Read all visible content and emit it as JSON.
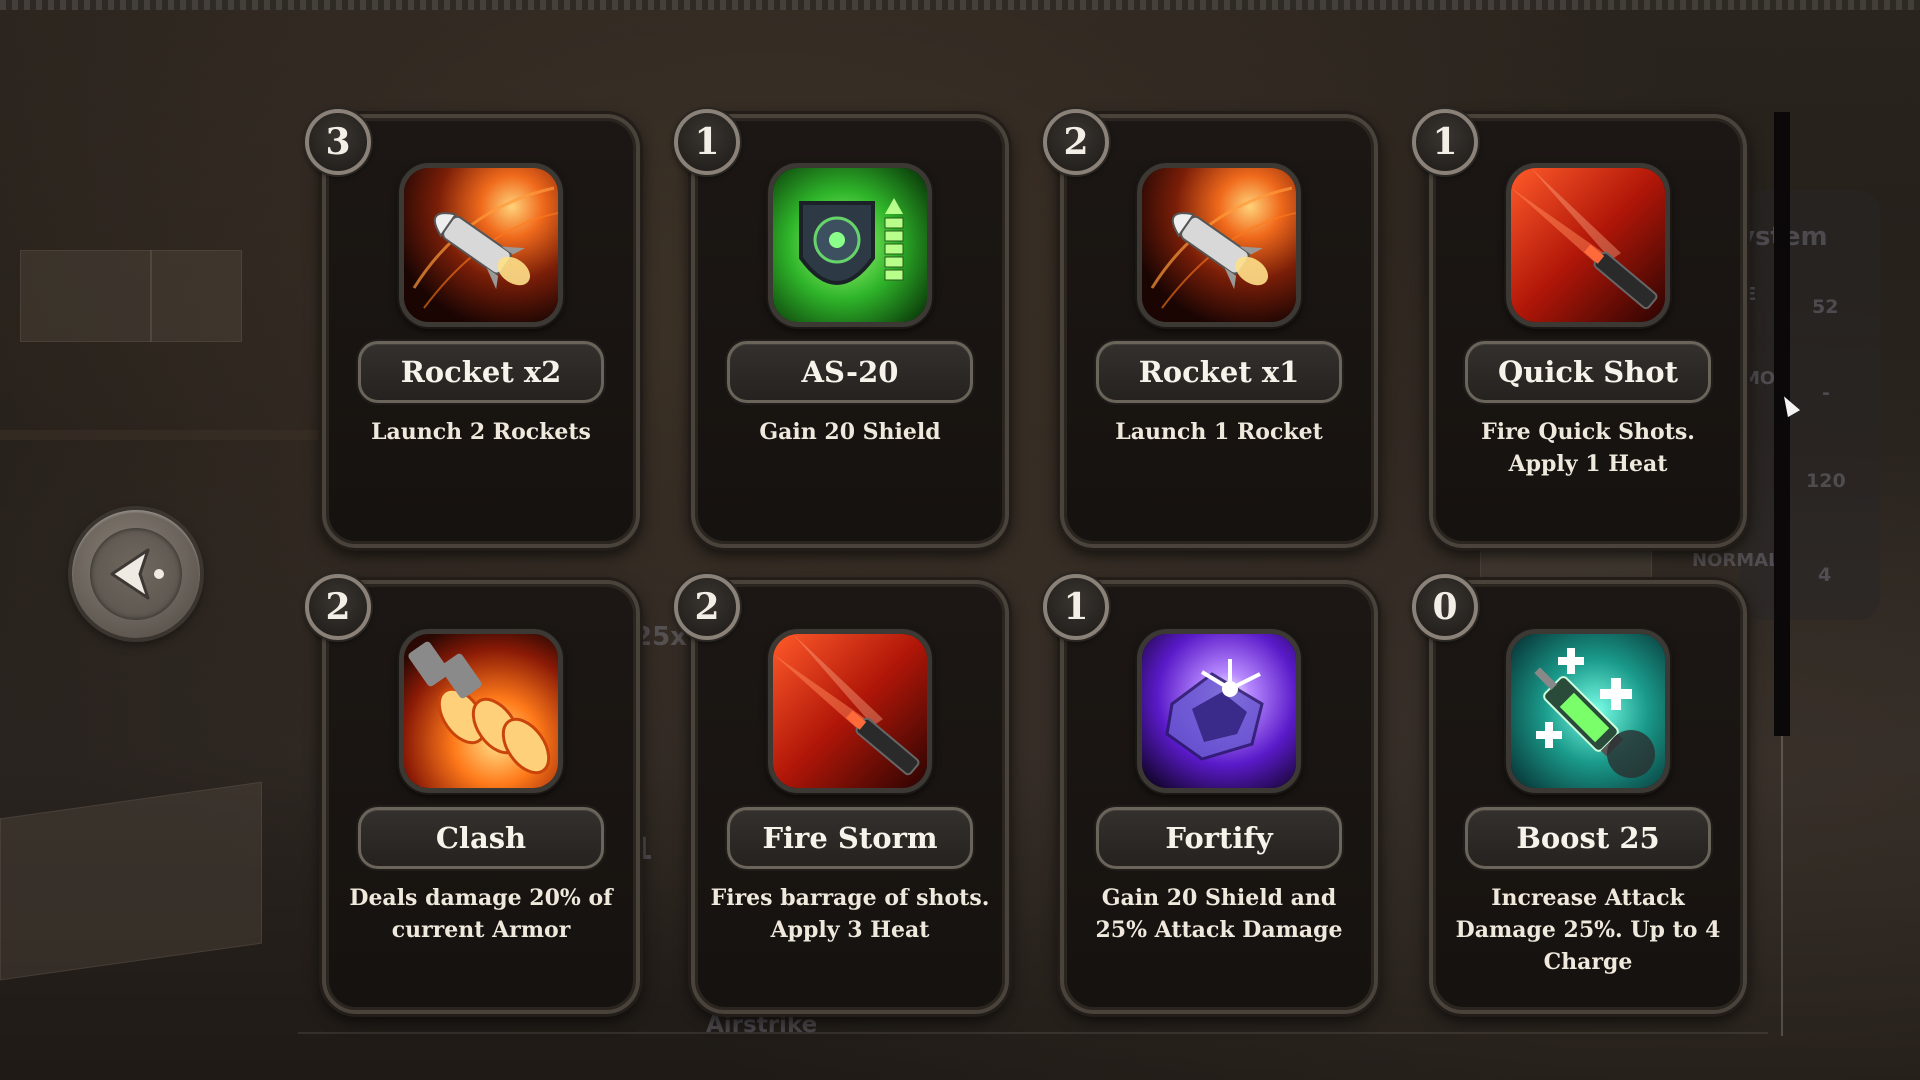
{
  "background": {
    "text_system": "ystem",
    "text_e": "E",
    "text_52": "52",
    "text_mo": "MO",
    "text_dash": "-",
    "text_120": "120",
    "text_normal": "NORMAL",
    "text_4": "4",
    "text_25x": "25x",
    "text_airstrike": "Airstrike",
    "text_1": "1"
  },
  "back_button": {
    "icon": "back-arrow-icon"
  },
  "cards": [
    {
      "count": "3",
      "name": "Rocket x2",
      "description": "Launch 2 Rockets",
      "icon": "rocket-icon"
    },
    {
      "count": "1",
      "name": "AS-20",
      "description": "Gain 20 Shield",
      "icon": "shield-icon"
    },
    {
      "count": "2",
      "name": "Rocket x1",
      "description": "Launch 1 Rocket",
      "icon": "rocket-icon"
    },
    {
      "count": "1",
      "name": "Quick Shot",
      "description": "Fire Quick Shots. Apply 1 Heat",
      "icon": "gun-barrel-icon"
    },
    {
      "count": "2",
      "name": "Clash",
      "description": "Deals damage 20% of current Armor",
      "icon": "rocket-barrage-icon"
    },
    {
      "count": "2",
      "name": "Fire Storm",
      "description": "Fires barrage of shots. Apply 3 Heat",
      "icon": "gun-barrel-icon"
    },
    {
      "count": "1",
      "name": "Fortify",
      "description": "Gain 20 Shield and 25% Attack Damage",
      "icon": "crystal-burst-icon"
    },
    {
      "count": "0",
      "name": "Boost 25",
      "description": "Increase Attack Damage 25%. Up to 4 Charge",
      "icon": "syringe-boost-icon"
    }
  ],
  "colors": {
    "card_border": "#4a433c",
    "badge_ring": "#8a8178",
    "text": "#f7f2ea"
  }
}
